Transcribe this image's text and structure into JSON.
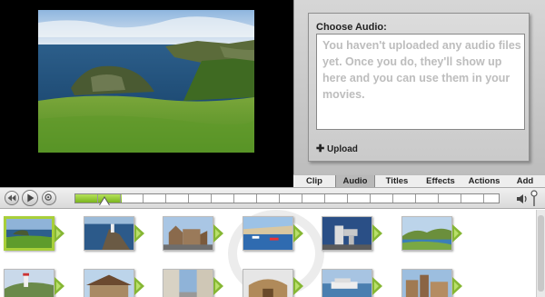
{
  "audio_panel": {
    "title": "Choose Audio:",
    "message": "You haven't uploaded any audio files yet.  Once you do, they'll show up here and you can use them in your movies.",
    "upload_label": "Upload"
  },
  "tabs": [
    {
      "label": "Clip",
      "active": false
    },
    {
      "label": "Audio",
      "active": true
    },
    {
      "label": "Titles",
      "active": false
    },
    {
      "label": "Effects",
      "active": false
    },
    {
      "label": "Actions",
      "active": false
    },
    {
      "label": "Add",
      "active": false
    }
  ],
  "transport": {
    "buttons": [
      "rewind-icon",
      "play-icon",
      "zoom-icon"
    ],
    "progress": 0.11,
    "playhead": 0.07
  },
  "timeline": {
    "clips_row1": [
      "coast-meadow",
      "lighthouse-cliff",
      "old-church",
      "harbor-boats",
      "modern-sculpture",
      "green-hills"
    ],
    "clips_row2": [
      "hill-lighthouse",
      "market-hall",
      "narrow-street",
      "cathedral",
      "river-boat",
      "stone-city"
    ],
    "selected_index": 0
  },
  "colors": {
    "accent_green": "#a8cf3a",
    "panel_gray": "#c8c8c8",
    "preview_bg": "#000000"
  }
}
